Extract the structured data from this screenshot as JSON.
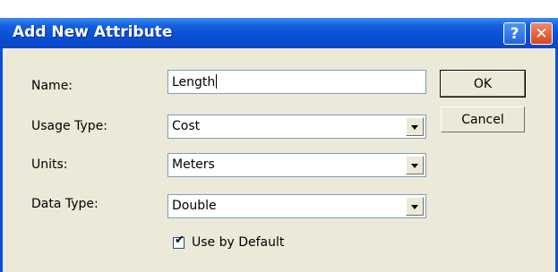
{
  "window": {
    "title": "Add New Attribute",
    "help_glyph": "?",
    "close_glyph": "✕"
  },
  "fields": {
    "name": {
      "label": "Name:",
      "value": "Length"
    },
    "usage_type": {
      "label": "Usage Type:",
      "value": "Cost"
    },
    "units": {
      "label": "Units:",
      "value": "Meters"
    },
    "data_type": {
      "label": "Data Type:",
      "value": "Double"
    }
  },
  "buttons": {
    "ok": "OK",
    "cancel": "Cancel"
  },
  "checkbox": {
    "label": "Use by Default",
    "checked": true,
    "mark": "✔"
  },
  "icons": [
    "help-icon",
    "close-icon",
    "dropdown-arrow-icon",
    "checkmark-icon"
  ],
  "colors": {
    "titlebar": "#0a4fd6",
    "client": "#ece9d8",
    "close": "#d6451f"
  }
}
